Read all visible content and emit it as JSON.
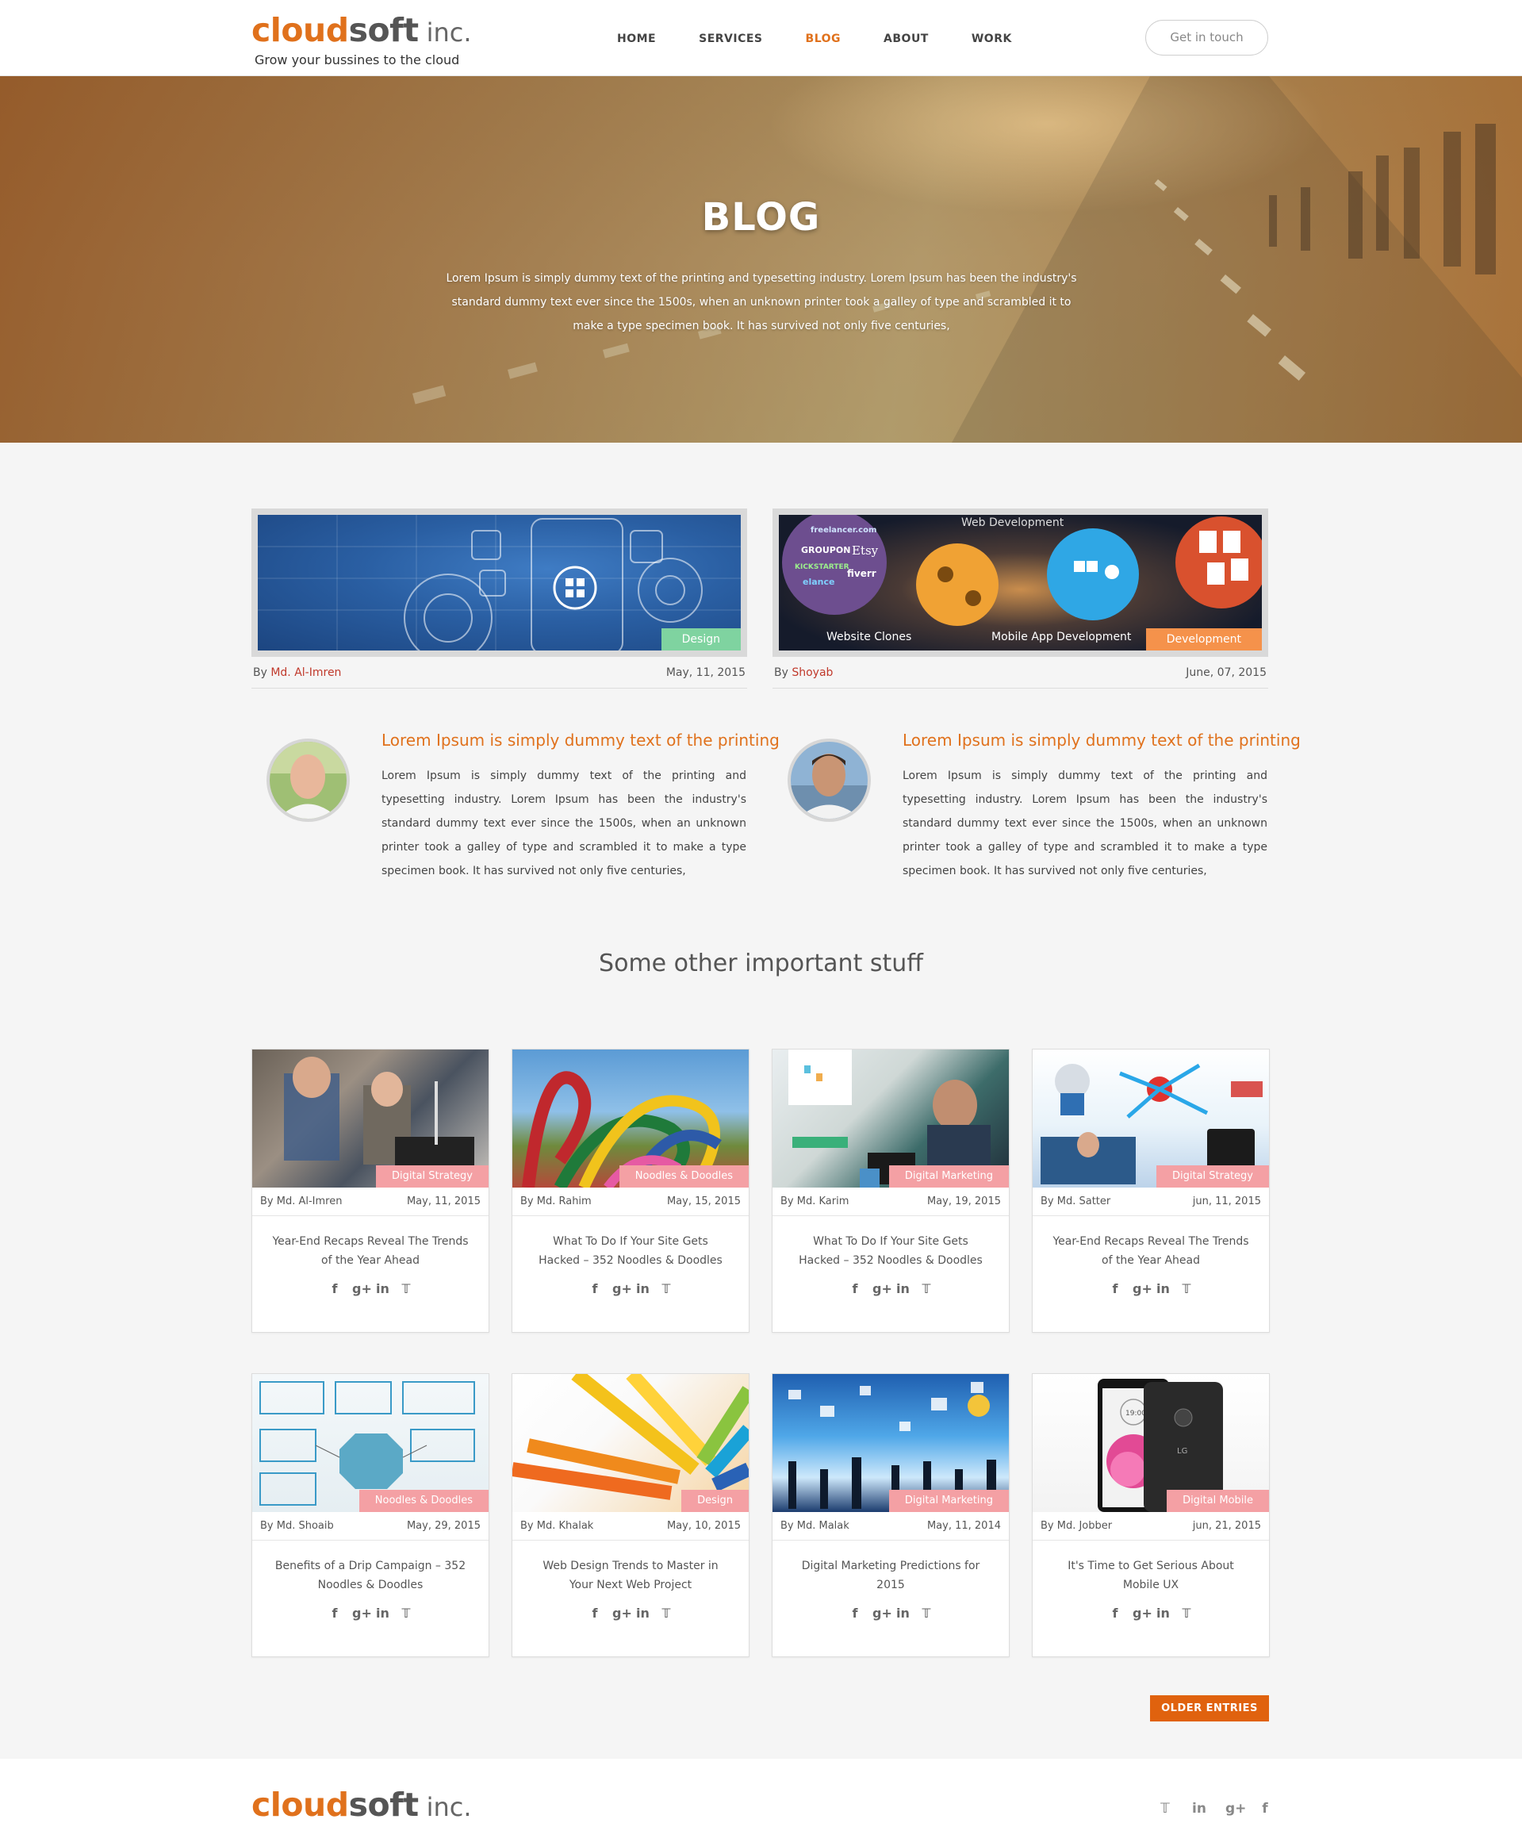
{
  "header": {
    "logo_cloud": "cloud",
    "logo_soft": "soft",
    "logo_inc": "inc.",
    "tagline": "Grow your bussines to the cloud",
    "nav": [
      "HOME",
      "SERVICES",
      "BLOG",
      "ABOUT",
      "WORK"
    ],
    "active_nav": "BLOG",
    "cta": "Get in touch"
  },
  "hero": {
    "title": "BLOG",
    "text": "Lorem Ipsum is simply dummy text of the printing and typesetting industry. Lorem Ipsum has been the industry's standard dummy text ever since the 1500s, when an unknown printer took a galley of type and scrambled it to make a type specimen book. It has survived not only five centuries,"
  },
  "featured": [
    {
      "tag": "Design",
      "by": "By",
      "author": "Md. Al-Imren",
      "date": "May, 11, 2015",
      "title": "Lorem Ipsum is simply dummy text of the printing",
      "text": "Lorem Ipsum is simply dummy text of the printing and typesetting industry. Lorem Ipsum has been the industry's standard dummy text ever since the 1500s, when an unknown printer took a galley of type and scrambled it to make a type specimen book. It has survived not only five centuries,"
    },
    {
      "tag": "Development",
      "by": "By",
      "author": "Shoyab",
      "date": "June, 07, 2015",
      "title": "Lorem Ipsum is simply dummy text of the printing",
      "text": "Lorem Ipsum is simply dummy text of the printing and typesetting industry. Lorem Ipsum has been the industry's standard dummy text ever since the 1500s, when an unknown printer took a galley of type and scrambled it to make a type specimen book. It has survived not only five centuries,",
      "image_labels": {
        "web": "Web Development",
        "clones": "Website Clones",
        "mobile": "Mobile App Development",
        "freelancer": "freelancer.com",
        "groupon": "GROUPON",
        "etsy": "Etsy",
        "kickstarter": "KICKSTARTER",
        "fiverr": "fiverr",
        "elance": "elance"
      }
    }
  ],
  "section_title": "Some other important stuff",
  "cards": [
    {
      "tag": "Digital Strategy",
      "author": "By Md. Al-Imren",
      "date": "May, 11, 2015",
      "title": "Year-End Recaps Reveal The Trends of the Year Ahead"
    },
    {
      "tag": "Noodles & Doodles",
      "author": "By Md. Rahim",
      "date": "May, 15, 2015",
      "title": "What To Do If Your Site Gets Hacked – 352 Noodles & Doodles"
    },
    {
      "tag": "Digital Marketing",
      "author": "By Md. Karim",
      "date": "May, 19, 2015",
      "title": "What To Do If Your Site Gets Hacked – 352 Noodles & Doodles"
    },
    {
      "tag": "Digital Strategy",
      "author": "By Md. Satter",
      "date": "jun, 11, 2015",
      "title": "Year-End Recaps Reveal The Trends of the Year Ahead"
    },
    {
      "tag": "Noodles & Doodles",
      "author": "By Md. Shoaib",
      "date": "May, 29, 2015",
      "title": "Benefits of a Drip Campaign – 352 Noodles & Doodles"
    },
    {
      "tag": "Design",
      "author": "By Md. Khalak",
      "date": "May, 10, 2015",
      "title": "Web Design Trends to Master in Your Next Web Project"
    },
    {
      "tag": "Digital Marketing",
      "author": "By Md. Malak",
      "date": "May, 11, 2014",
      "title": "Digital Marketing Predictions for 2015"
    },
    {
      "tag": "Digital  Mobile",
      "author": "By Md. Jobber",
      "date": "jun, 21, 2015",
      "title": "It's Time to Get Serious About Mobile UX"
    }
  ],
  "card_social": [
    "f",
    "g+",
    "in",
    "t"
  ],
  "phone_time": "19:00",
  "phone_brand": "LG",
  "older_entries": "OLDER ENTRIES",
  "footer": {
    "logo_cloud": "cloud",
    "logo_soft": "soft",
    "logo_inc": "inc.",
    "social": [
      "t",
      "in",
      "g+",
      "f"
    ]
  },
  "colors": {
    "accent": "#e0711c",
    "tag_design": "#7fd3a0",
    "tag_development": "#f5924b",
    "card_tag": "#f4a0a4",
    "button": "#e0620e"
  }
}
